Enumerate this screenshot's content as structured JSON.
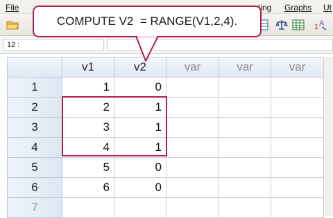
{
  "menu": {
    "file": "File",
    "utilities": "ting",
    "graphs": "Graphs",
    "utilities_right": "Ut"
  },
  "editor": {
    "cell_ref": "12 :",
    "cell_value": ""
  },
  "callout": {
    "text": "COMPUTE V2  = RANGE(V1,2,4)."
  },
  "grid": {
    "columns": [
      "v1",
      "v2",
      "var",
      "var",
      "var"
    ],
    "rows": [
      {
        "index": "1",
        "v1": "1",
        "v2": "0"
      },
      {
        "index": "2",
        "v1": "2",
        "v2": "1"
      },
      {
        "index": "3",
        "v1": "3",
        "v2": "1"
      },
      {
        "index": "4",
        "v1": "4",
        "v2": "1"
      },
      {
        "index": "5",
        "v1": "5",
        "v2": "0"
      },
      {
        "index": "6",
        "v1": "6",
        "v2": "0"
      },
      {
        "index": "7",
        "v1": "",
        "v2": ""
      }
    ]
  },
  "colors": {
    "accent": "#b01e4a",
    "header_bg": "#dfe8f3"
  },
  "icons": [
    "folder-open-icon",
    "variable-view-icon",
    "scale-icon",
    "grid-icon",
    "value-labels-icon"
  ]
}
